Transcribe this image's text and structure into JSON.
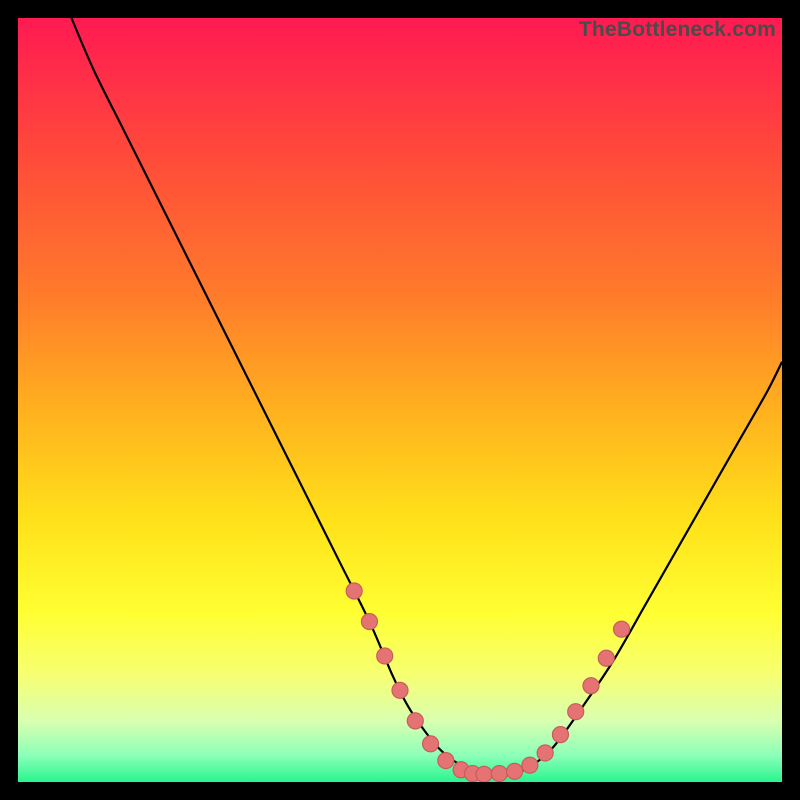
{
  "watermark": "TheBottleneck.com",
  "colors": {
    "frame": "#000000",
    "curve": "#000000",
    "marker_fill": "#e57373",
    "marker_stroke": "#c75a5a",
    "gradient_stops": [
      {
        "offset": 0.0,
        "color": "#ff1a52"
      },
      {
        "offset": 0.18,
        "color": "#ff4a3a"
      },
      {
        "offset": 0.36,
        "color": "#ff7a2b"
      },
      {
        "offset": 0.52,
        "color": "#ffb31e"
      },
      {
        "offset": 0.66,
        "color": "#ffe21a"
      },
      {
        "offset": 0.78,
        "color": "#ffff33"
      },
      {
        "offset": 0.86,
        "color": "#f6ff72"
      },
      {
        "offset": 0.92,
        "color": "#d9ffb0"
      },
      {
        "offset": 0.965,
        "color": "#8cffb8"
      },
      {
        "offset": 1.0,
        "color": "#29f58f"
      }
    ]
  },
  "chart_data": {
    "type": "line",
    "title": "",
    "xlabel": "",
    "ylabel": "",
    "xlim": [
      0,
      100
    ],
    "ylim": [
      0,
      100
    ],
    "grid": false,
    "legend": false,
    "series": [
      {
        "name": "bottleneck-curve",
        "x": [
          7,
          10,
          14,
          18,
          22,
          26,
          30,
          34,
          38,
          42,
          46,
          49,
          51,
          53,
          55,
          57,
          59,
          61,
          63,
          65,
          67,
          70,
          74,
          78,
          82,
          86,
          90,
          94,
          98,
          100
        ],
        "y": [
          100,
          93,
          85,
          77,
          69,
          61,
          53,
          45,
          37,
          29,
          21,
          14,
          10,
          7,
          4.5,
          2.8,
          1.8,
          1.2,
          1.0,
          1.2,
          2.0,
          4.5,
          10,
          16,
          23,
          30,
          37,
          44,
          51,
          55
        ]
      }
    ],
    "markers": {
      "name": "highlight-points",
      "points": [
        {
          "x": 44,
          "y": 25
        },
        {
          "x": 46,
          "y": 21
        },
        {
          "x": 48,
          "y": 16.5
        },
        {
          "x": 50,
          "y": 12
        },
        {
          "x": 52,
          "y": 8
        },
        {
          "x": 54,
          "y": 5
        },
        {
          "x": 56,
          "y": 2.8
        },
        {
          "x": 58,
          "y": 1.6
        },
        {
          "x": 59.5,
          "y": 1.1
        },
        {
          "x": 61,
          "y": 1.0
        },
        {
          "x": 63,
          "y": 1.1
        },
        {
          "x": 65,
          "y": 1.4
        },
        {
          "x": 67,
          "y": 2.2
        },
        {
          "x": 69,
          "y": 3.8
        },
        {
          "x": 71,
          "y": 6.2
        },
        {
          "x": 73,
          "y": 9.2
        },
        {
          "x": 75,
          "y": 12.6
        },
        {
          "x": 77,
          "y": 16.2
        },
        {
          "x": 79,
          "y": 20.0
        }
      ]
    }
  }
}
